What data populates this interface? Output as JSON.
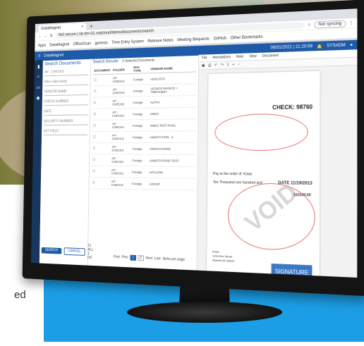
{
  "browser": {
    "tab_title": "DataMagnet",
    "tab_close": "×",
    "new_tab": "+",
    "address": "Not secure | sb-dm-01.vodcloud/demo/documents/search",
    "profile": "Not syncing",
    "bookmarks": [
      "Apps",
      "DataMagnet",
      "OfficeScan",
      "genesis",
      "Time Entry System",
      "Release Notes",
      "Meeting Bequests",
      "GitHub",
      "Other Bookmarks"
    ]
  },
  "app": {
    "logo": "DataMagnet",
    "datetime": "08/31/2022 | 21:20:59",
    "user": "SYSADM"
  },
  "search": {
    "title": "Search Documents",
    "doc_type": "AP - CHECKS",
    "filter_label": "Filter index fields",
    "fields": [
      "VENDOR NAME",
      "CHECK NUMBER",
      "DATE",
      "SECURITY NUMBER",
      "SET FIELD"
    ],
    "search_btn": "SEARCH",
    "cancel_btn": "CANCEL",
    "count": "21 ALL 1 OF"
  },
  "results": {
    "title": "Search Results",
    "selected": "0 Selected Documents",
    "columns": [
      "DOCUMENT",
      "FOLDER",
      "DOC TYPE",
      "VENDOR NAME"
    ],
    "rows": [
      [
        "AP - CHECKS",
        "Foreign",
        "ADOLFO'S"
      ],
      [
        "AP - CHECKS",
        "Foreign",
        "AGGIE'S INVOICE + TIMESHEET"
      ],
      [
        "AP - CHECKS",
        "Foreign",
        "ALPHA"
      ],
      [
        "AP - CHECKS",
        "Foreign",
        "AMKO"
      ],
      [
        "AP - CHECKS",
        "Foreign",
        "AMKO TEST FINAL"
      ],
      [
        "AP - CHECKS",
        "Foreign",
        "ANNOTATION - 2"
      ],
      [
        "AP - CHECKS",
        "Foreign",
        "ANNOTATIONS"
      ],
      [
        "AP - CHECKS",
        "Foreign",
        "ANNOTATIONS TEST"
      ],
      [
        "AP - CHECKS",
        "Foreign",
        "APCLERK"
      ],
      [
        "AP - CHECKS",
        "Foreign",
        "ASSHIP"
      ]
    ],
    "pager": {
      "first": "First",
      "prev": "Prev",
      "p1": "1",
      "p2": "2",
      "next": "Next",
      "last": "Last"
    },
    "per_page": "Items per page"
  },
  "viewer": {
    "menu": [
      "File",
      "Annotations",
      "Note",
      "View",
      "Document"
    ],
    "page_num": "1",
    "check_number": "CHECK: 98760",
    "pay_to": "Pay to the order of: Kolax",
    "amount_words": "Ten Thousand one hundred and",
    "date": "DATE 11/19/2013",
    "amount": "$10100.00",
    "void": "VOID",
    "address": [
      "Kolax",
      "1234 Elm Street",
      "Atlanta GA 30303"
    ],
    "signature": "SIGNATURE"
  },
  "marketing": {
    "side_text": "ed"
  }
}
